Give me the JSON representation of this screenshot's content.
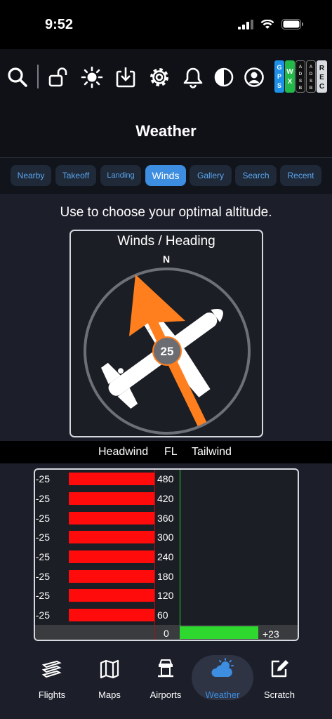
{
  "status_bar": {
    "time": "9:52"
  },
  "toolbar": {
    "icons": [
      "search-icon",
      "unlock-icon",
      "brightness-icon",
      "download-icon",
      "settings-icon",
      "bell-icon",
      "contrast-icon",
      "user-icon"
    ],
    "badges": {
      "gps": "GPS",
      "wx": "WX",
      "adsb1": "ADSB",
      "adsb2": "ADSB",
      "rec": "REC"
    },
    "colors": {
      "gps": "#1e90e8",
      "wx": "#23b84a",
      "rec": "#d9dce0"
    }
  },
  "header": {
    "title": "Weather"
  },
  "tabs": [
    {
      "label": "Nearby"
    },
    {
      "label": "Takeoff"
    },
    {
      "label": "Landing"
    },
    {
      "label": "Winds",
      "active": true
    },
    {
      "label": "Gallery"
    },
    {
      "label": "Search"
    },
    {
      "label": "Recent"
    }
  ],
  "hint": "Use to choose your optimal altitude.",
  "compass": {
    "title": "Winds / Heading",
    "north_label": "N",
    "wind_value": "25",
    "colors": {
      "arrow": "#ff7f1e",
      "plane": "#ffffff"
    }
  },
  "wind_table": {
    "headers": {
      "headwind": "Headwind",
      "fl": "FL",
      "tailwind": "Tailwind"
    },
    "rows": [
      {
        "headwind": "-25",
        "fl": "480"
      },
      {
        "headwind": "-25",
        "fl": "420"
      },
      {
        "headwind": "-25",
        "fl": "360"
      },
      {
        "headwind": "-25",
        "fl": "300"
      },
      {
        "headwind": "-25",
        "fl": "240"
      },
      {
        "headwind": "-25",
        "fl": "180"
      },
      {
        "headwind": "-25",
        "fl": "120"
      },
      {
        "headwind": "-25",
        "fl": "60"
      }
    ],
    "surface": {
      "fl": "0",
      "tailwind": "+23"
    },
    "colors": {
      "headwind_bar": "#ff0b0b",
      "tailwind_bar": "#2fd82f"
    }
  },
  "tab_bar": {
    "items": [
      {
        "label": "Flights"
      },
      {
        "label": "Maps"
      },
      {
        "label": "Airports"
      },
      {
        "label": "Weather",
        "active": true
      },
      {
        "label": "Scratch"
      }
    ]
  }
}
